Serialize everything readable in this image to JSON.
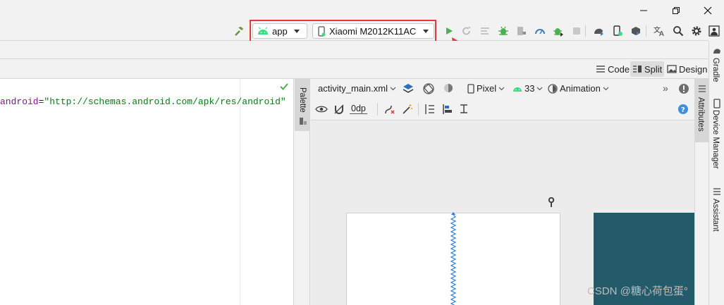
{
  "toolbar": {
    "config_label": "app",
    "device_label": "Xiaomi M2012K11AC"
  },
  "view_modes": {
    "code": "Code",
    "split": "Split",
    "design": "Design"
  },
  "code": {
    "attr": "android",
    "equals": "=",
    "value": "\"http://schemas.android.com/apk/res/android\""
  },
  "design_toolbar": {
    "file": "activity_main.xml",
    "device": "Pixel",
    "api": "33",
    "animation": "Animation",
    "margin": "0dp",
    "overflow": "»"
  },
  "side_tabs": {
    "palette": "Palette",
    "attributes": "Attributes",
    "gradle": "Gradle",
    "device_manager": "Device Manager",
    "assistant": "Assistant"
  },
  "watermark": "CSDN @糖心荷包蛋°",
  "colors": {
    "accent_red": "#e53935",
    "android_green": "#3ddc84",
    "run_green": "#4caf50",
    "blueprint": "#235b6b",
    "link_blue": "#2196f3"
  },
  "icons": [
    "hammer-icon",
    "android-icon",
    "phone-icon",
    "run-icon",
    "rerun-icon",
    "logcat-icon",
    "debug-icon",
    "attach-icon",
    "profile-icon",
    "apply-changes-icon",
    "stop-icon",
    "sync-icon",
    "device-mirror-icon",
    "sdk-icon",
    "translate-icon",
    "search-icon",
    "settings-icon",
    "account-icon"
  ]
}
